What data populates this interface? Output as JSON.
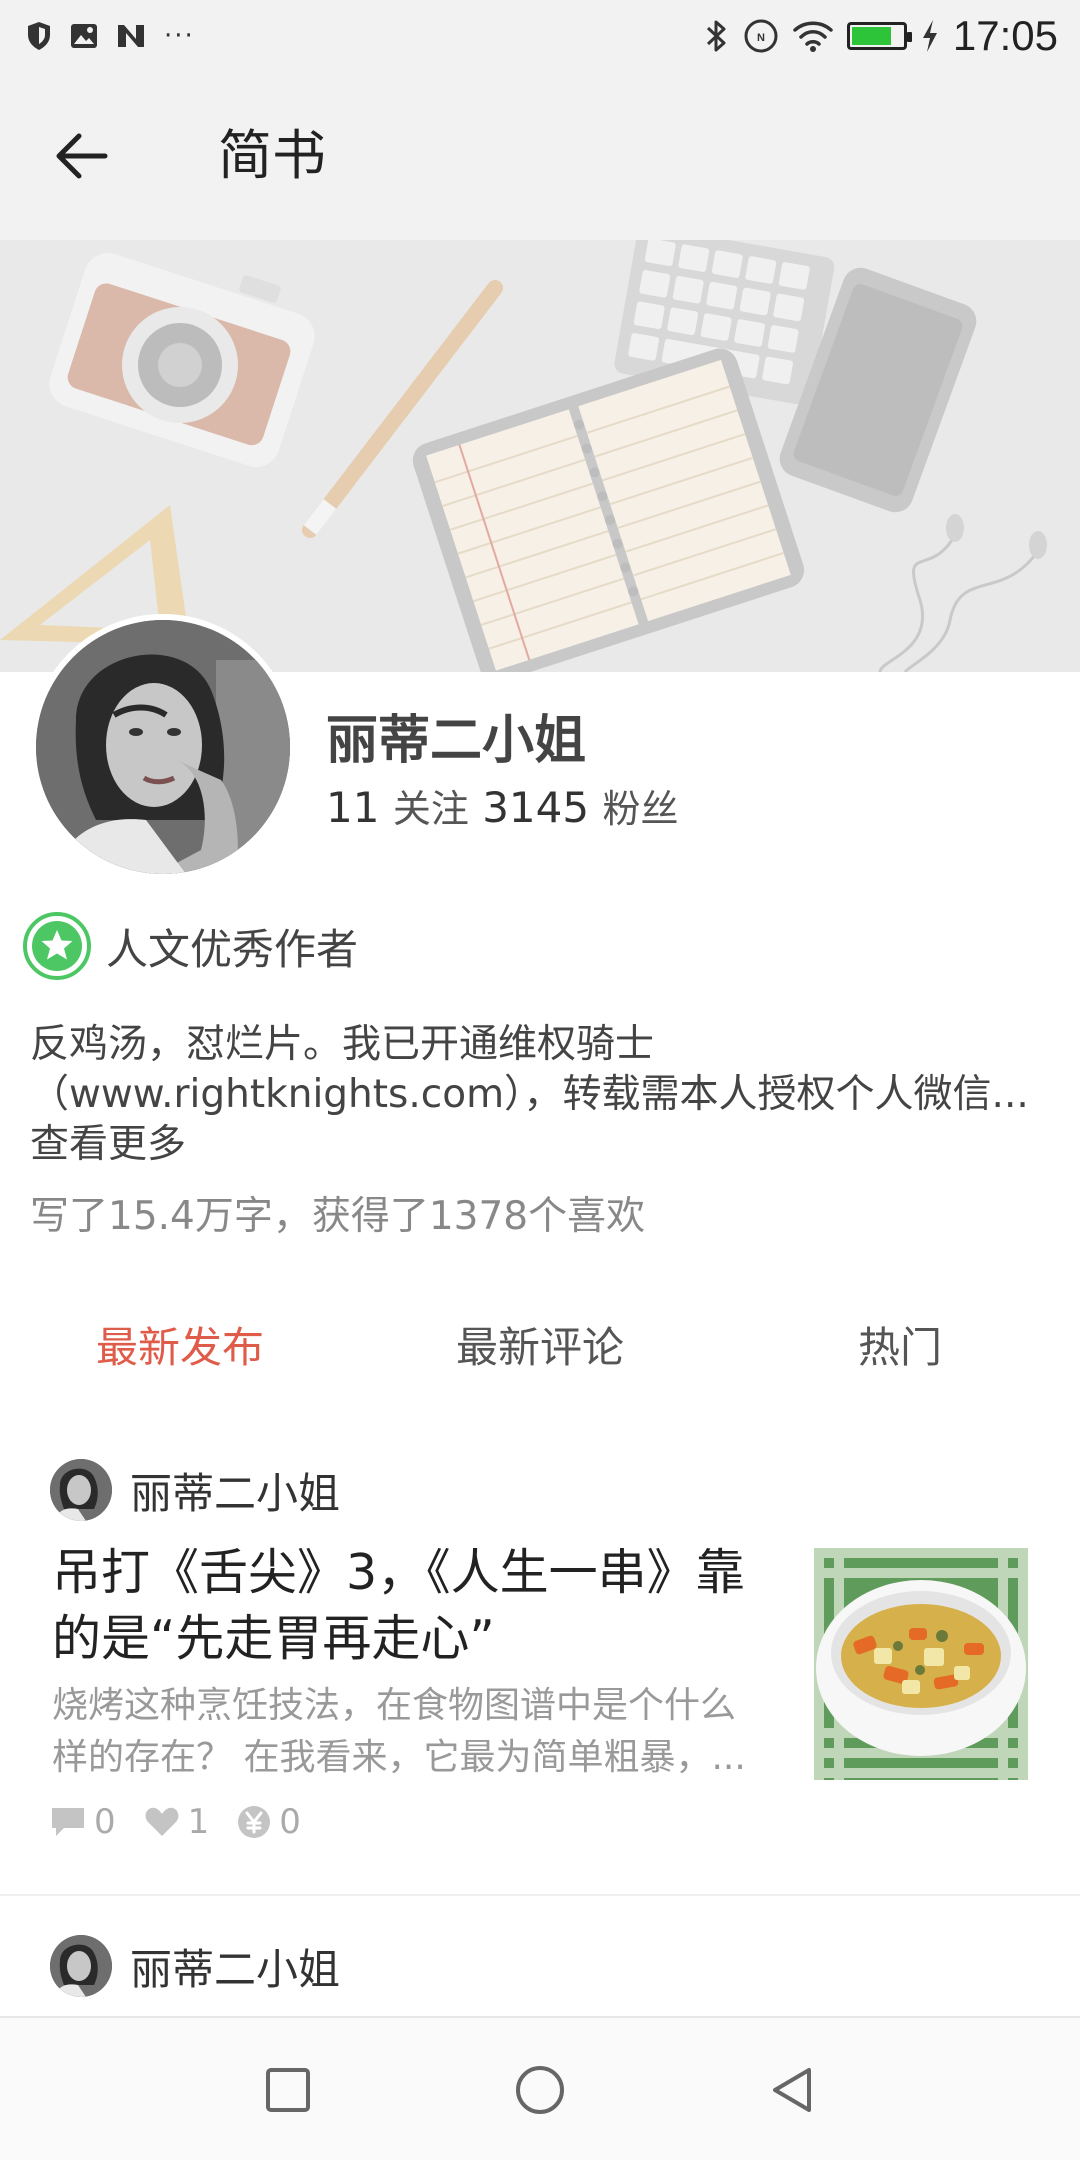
{
  "status_bar": {
    "time": "17:05",
    "overflow": "···",
    "left_icons": [
      "shield-icon",
      "image-icon",
      "n-app-icon"
    ],
    "right_icons": [
      "bluetooth-icon",
      "nfc-icon",
      "wifi-icon",
      "battery-icon",
      "charging-icon"
    ],
    "battery_level": 0.75,
    "battery_color": "#2ec43a"
  },
  "toolbar": {
    "title": "简书",
    "back_icon": "arrow-left-icon"
  },
  "profile": {
    "name": "丽蒂二小姐",
    "following_count": "11",
    "following_label": "关注",
    "followers_count": "3145",
    "followers_label": "粉丝",
    "badge_label": "人文优秀作者",
    "badge_color": "#4cc764",
    "bio": "反鸡汤，怼烂片。我已开通维权骑士（www.rightknights.com），转载需本人授权个人微信...查看更多",
    "summary": "写了15.4万字，获得了1378个喜欢"
  },
  "tabs": [
    {
      "label": "最新发布",
      "active": true
    },
    {
      "label": "最新评论",
      "active": false
    },
    {
      "label": "热门",
      "active": false
    }
  ],
  "accent_color": "#e05c4a",
  "feed": [
    {
      "author": "丽蒂二小姐",
      "title": "吊打《舌尖》3，《人生一串》靠的是“先走胃再走心”",
      "excerpt": "烧烤这种烹饪技法，在食物图谱中是个什么样的存在？ 在我看来，它最为简单粗暴，...",
      "comments": "0",
      "likes": "1",
      "rewards": "0"
    },
    {
      "author": "丽蒂二小姐"
    }
  ],
  "nav_bar": {
    "buttons": [
      "recent-apps-icon",
      "home-icon",
      "back-triangle-icon"
    ]
  }
}
